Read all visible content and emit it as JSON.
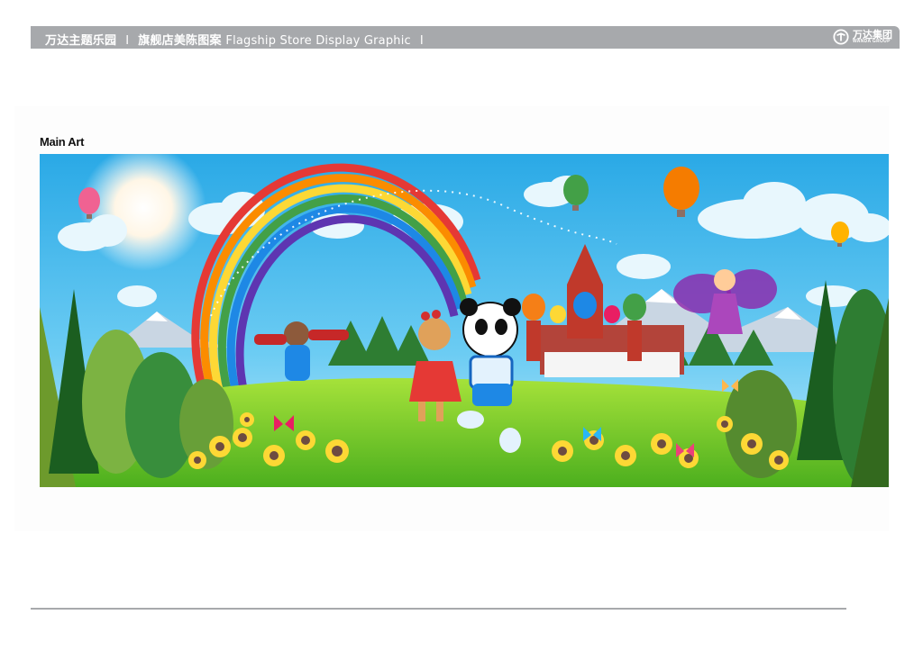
{
  "header": {
    "park_name": "万达主题乐园",
    "separator": "I",
    "section_cn": "旗舰店美陈图案",
    "section_en": "Flagship Store Display Graphic",
    "trailing_separator": "I",
    "bar_color": "#a7a9ac"
  },
  "logo": {
    "cn": "万达集团",
    "en": "WANDA GROUP",
    "icon": "wanda-logo-icon"
  },
  "main": {
    "title": "Main Art"
  },
  "artwork": {
    "scene": "illustrated-fairytale-landscape",
    "colors": {
      "sky": "#3bb4ea",
      "grass": "#7fcf2b",
      "trees": "#2f8f3a"
    }
  }
}
